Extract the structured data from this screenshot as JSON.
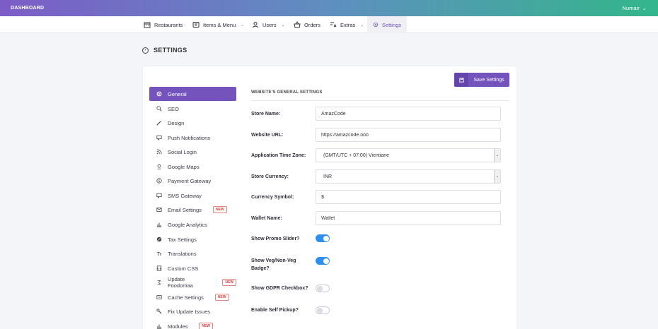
{
  "topbar": {
    "brand": "DASHBOARD",
    "user": "Numair"
  },
  "nav": [
    {
      "label": "Restaurants",
      "icon": "store-icon"
    },
    {
      "label": "Items & Menu",
      "icon": "menu-icon",
      "dropdown": true
    },
    {
      "label": "Users",
      "icon": "users-icon",
      "dropdown": true
    },
    {
      "label": "Orders",
      "icon": "basket-icon"
    },
    {
      "label": "Extras",
      "icon": "extras-icon",
      "dropdown": true
    },
    {
      "label": "Settings",
      "icon": "gear-icon",
      "active": true
    }
  ],
  "page": {
    "title": "SETTINGS"
  },
  "save_button": {
    "label": "Save Settings"
  },
  "sidebar": [
    {
      "label": "General",
      "active": true
    },
    {
      "label": "SEO"
    },
    {
      "label": "Design"
    },
    {
      "label": "Push Notifications"
    },
    {
      "label": "Social Login"
    },
    {
      "label": "Google Maps"
    },
    {
      "label": "Payment Gateway"
    },
    {
      "label": "SMS Gateway"
    },
    {
      "label": "Email Settings",
      "badge": "NEW"
    },
    {
      "label": "Google Analytics"
    },
    {
      "label": "Tax Settings"
    },
    {
      "label": "Translations"
    },
    {
      "label": "Custom CSS"
    },
    {
      "label": "Update Foodomaa",
      "badge": "NEW"
    },
    {
      "label": "Cache Settings",
      "badge": "NEW"
    },
    {
      "label": "Fix Update Issues"
    },
    {
      "label": "Modules",
      "badge": "NEW"
    }
  ],
  "form": {
    "section_title": "WEBSITE'S GENERAL SETTINGS",
    "store_name": {
      "label": "Store Name:",
      "value": "AmazCode"
    },
    "website_url": {
      "label": "Website URL:",
      "value": "https://amazcode.ooo"
    },
    "timezone": {
      "label": "Application Time Zone:",
      "value": "(GMT/UTC + 07:00) Vientiane"
    },
    "currency": {
      "label": "Store Currency:",
      "value": "INR"
    },
    "currency_symbol": {
      "label": "Currency Symbol:",
      "value": "$"
    },
    "wallet_name": {
      "label": "Wallet Name:",
      "value": "Wallet"
    },
    "promo_slider": {
      "label": "Show Promo Slider?",
      "on": true
    },
    "veg_badge": {
      "label": "Show Veg/Non-Veg Badge?",
      "on": true
    },
    "gdpr": {
      "label": "Show GDPR Checkbox?",
      "on": false
    },
    "self_pickup": {
      "label": "Enable Self Pickup?",
      "on": false
    }
  },
  "colors": {
    "accent": "#7453bd",
    "toggle_on": "#2f8ff0",
    "badge": "#d84040"
  }
}
